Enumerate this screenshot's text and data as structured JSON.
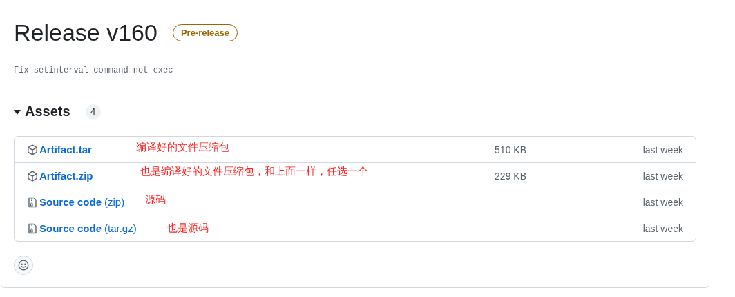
{
  "release": {
    "title": "Release v160",
    "badge": "Pre-release",
    "description": "Fix setinterval command not exec"
  },
  "assets": {
    "heading": "Assets",
    "expanded": true,
    "count": "4",
    "items": [
      {
        "kind": "package",
        "name": "Artifact.tar",
        "note": "编译好的文件压缩包",
        "size": "510 KB",
        "date": "last week"
      },
      {
        "kind": "package",
        "name": "Artifact.zip",
        "note": "也是编译好的文件压缩包，和上面一样，任选一个",
        "size": "229 KB",
        "date": "last week"
      },
      {
        "kind": "source",
        "name": "Source code",
        "suffix": "(zip)",
        "note": "源码",
        "date": "last week"
      },
      {
        "kind": "source",
        "name": "Source code",
        "suffix": "(tar.gz)",
        "note": "也是源码",
        "date": "last week"
      }
    ]
  }
}
